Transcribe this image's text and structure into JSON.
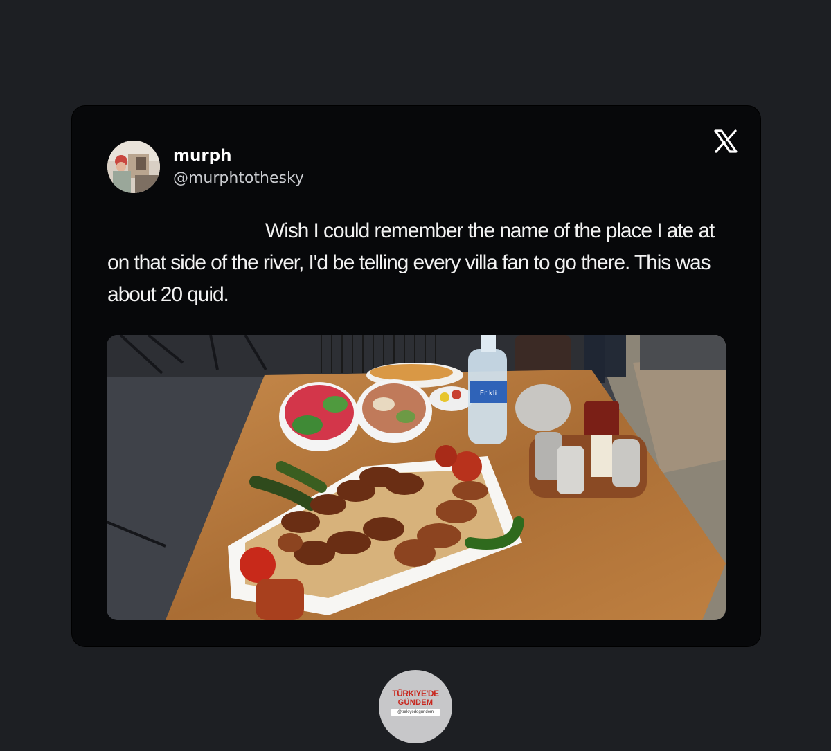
{
  "post": {
    "display_name": "murph",
    "handle": "@murphtothesky",
    "text": "Wish I could remember the name of the place I ate at on that side of the river, I'd be telling every villa fan to go there. This was about 20 quid.",
    "platform_icon": "x-logo-icon",
    "avatar_icon": "avatar-photo",
    "media": {
      "icon": "food-photo",
      "water_bottle_label": "Erikli"
    }
  },
  "watermark": {
    "line1": "TÜRKIYE'DE",
    "line2": "GÜNDEM",
    "handle": "@turkiyedegundem"
  },
  "colors": {
    "page_background": "#1d1f23",
    "card_background": "#07080a",
    "text_primary": "#ffffff",
    "text_secondary": "#c9cbcf",
    "watermark_red": "#c8281f"
  }
}
